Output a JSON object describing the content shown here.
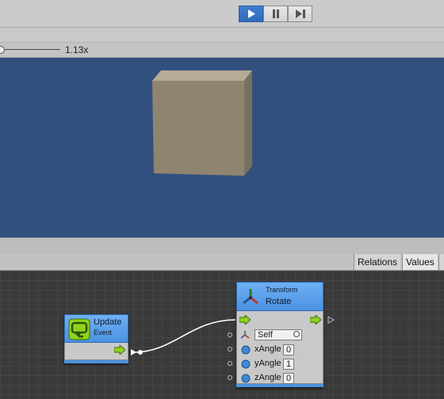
{
  "toolbar": {
    "play_icon": "play-icon",
    "pause_icon": "pause-icon",
    "step_icon": "step-icon",
    "accent": "#2f6bbd"
  },
  "scene": {
    "zoom_label": "1.13x",
    "background": "#31507e",
    "cube_color": "#8f8470"
  },
  "tabs": [
    "Relations",
    "Values"
  ],
  "graph": {
    "nodes": {
      "update": {
        "title": "Update",
        "subtitle": "Event",
        "icon": "update-event-icon"
      },
      "rotate": {
        "category": "Transform",
        "title": "Rotate",
        "icon": "transform-axes-icon",
        "target_label": "Self",
        "params": [
          {
            "label": "xAngle",
            "value": "0"
          },
          {
            "label": "yAngle",
            "value": "1"
          },
          {
            "label": "zAngle",
            "value": "0"
          }
        ]
      }
    }
  }
}
